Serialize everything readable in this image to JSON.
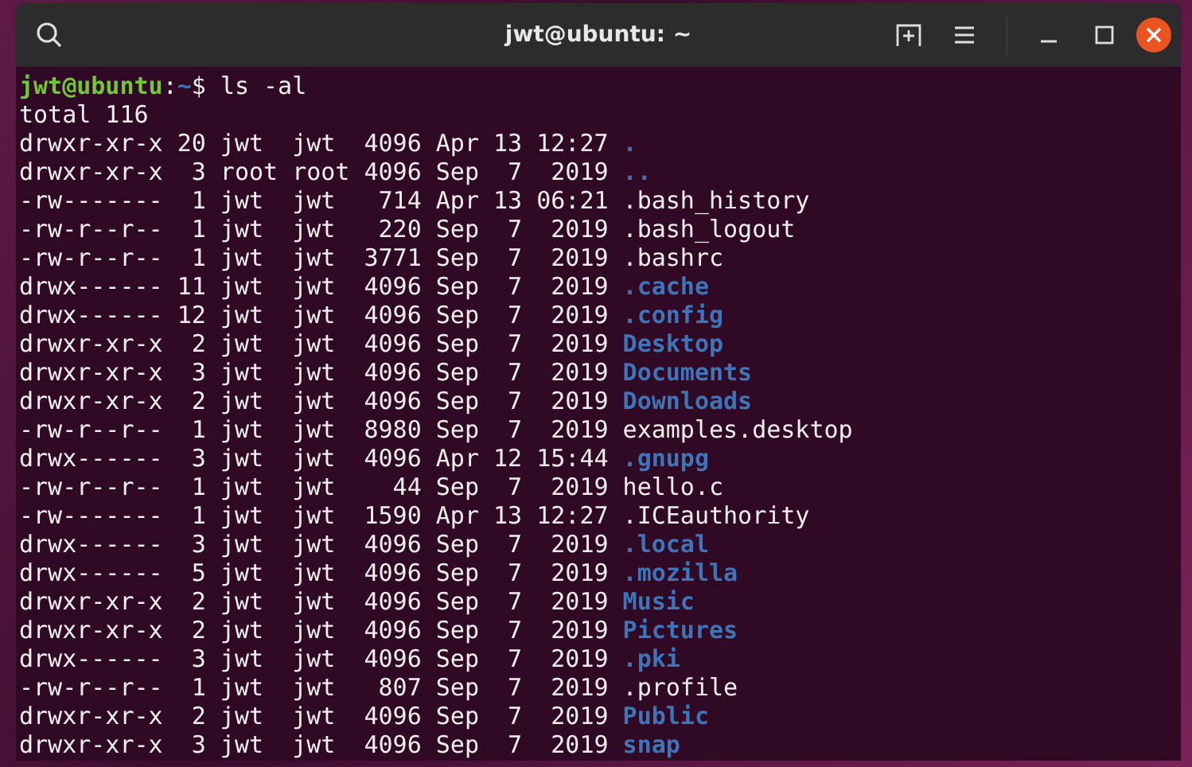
{
  "window": {
    "title": "jwt@ubuntu: ~"
  },
  "prompt": {
    "user_host": "jwt@ubuntu",
    "separator": ":",
    "path": "~",
    "symbol": "$",
    "command": "ls -al"
  },
  "summary": "total 116",
  "entries": [
    {
      "listing": "drwxr-xr-x 20 jwt  jwt  4096 Apr 13 12:27",
      "name": ".",
      "kind": "dir"
    },
    {
      "listing": "drwxr-xr-x  3 root root 4096 Sep  7  2019",
      "name": "..",
      "kind": "dir"
    },
    {
      "listing": "-rw-------  1 jwt  jwt   714 Apr 13 06:21",
      "name": ".bash_history",
      "kind": "file"
    },
    {
      "listing": "-rw-r--r--  1 jwt  jwt   220 Sep  7  2019",
      "name": ".bash_logout",
      "kind": "file"
    },
    {
      "listing": "-rw-r--r--  1 jwt  jwt  3771 Sep  7  2019",
      "name": ".bashrc",
      "kind": "file"
    },
    {
      "listing": "drwx------ 11 jwt  jwt  4096 Sep  7  2019",
      "name": ".cache",
      "kind": "dir"
    },
    {
      "listing": "drwx------ 12 jwt  jwt  4096 Sep  7  2019",
      "name": ".config",
      "kind": "dir"
    },
    {
      "listing": "drwxr-xr-x  2 jwt  jwt  4096 Sep  7  2019",
      "name": "Desktop",
      "kind": "dir"
    },
    {
      "listing": "drwxr-xr-x  3 jwt  jwt  4096 Sep  7  2019",
      "name": "Documents",
      "kind": "dir"
    },
    {
      "listing": "drwxr-xr-x  2 jwt  jwt  4096 Sep  7  2019",
      "name": "Downloads",
      "kind": "dir"
    },
    {
      "listing": "-rw-r--r--  1 jwt  jwt  8980 Sep  7  2019",
      "name": "examples.desktop",
      "kind": "file"
    },
    {
      "listing": "drwx------  3 jwt  jwt  4096 Apr 12 15:44",
      "name": ".gnupg",
      "kind": "dir"
    },
    {
      "listing": "-rw-r--r--  1 jwt  jwt    44 Sep  7  2019",
      "name": "hello.c",
      "kind": "file"
    },
    {
      "listing": "-rw-------  1 jwt  jwt  1590 Apr 13 12:27",
      "name": ".ICEauthority",
      "kind": "file"
    },
    {
      "listing": "drwx------  3 jwt  jwt  4096 Sep  7  2019",
      "name": ".local",
      "kind": "dir"
    },
    {
      "listing": "drwx------  5 jwt  jwt  4096 Sep  7  2019",
      "name": ".mozilla",
      "kind": "dir"
    },
    {
      "listing": "drwxr-xr-x  2 jwt  jwt  4096 Sep  7  2019",
      "name": "Music",
      "kind": "dir"
    },
    {
      "listing": "drwxr-xr-x  2 jwt  jwt  4096 Sep  7  2019",
      "name": "Pictures",
      "kind": "dir"
    },
    {
      "listing": "drwx------  3 jwt  jwt  4096 Sep  7  2019",
      "name": ".pki",
      "kind": "dir"
    },
    {
      "listing": "-rw-r--r--  1 jwt  jwt   807 Sep  7  2019",
      "name": ".profile",
      "kind": "file"
    },
    {
      "listing": "drwxr-xr-x  2 jwt  jwt  4096 Sep  7  2019",
      "name": "Public",
      "kind": "dir"
    },
    {
      "listing": "drwxr-xr-x  3 jwt  jwt  4096 Sep  7  2019",
      "name": "snap",
      "kind": "dir"
    }
  ]
}
